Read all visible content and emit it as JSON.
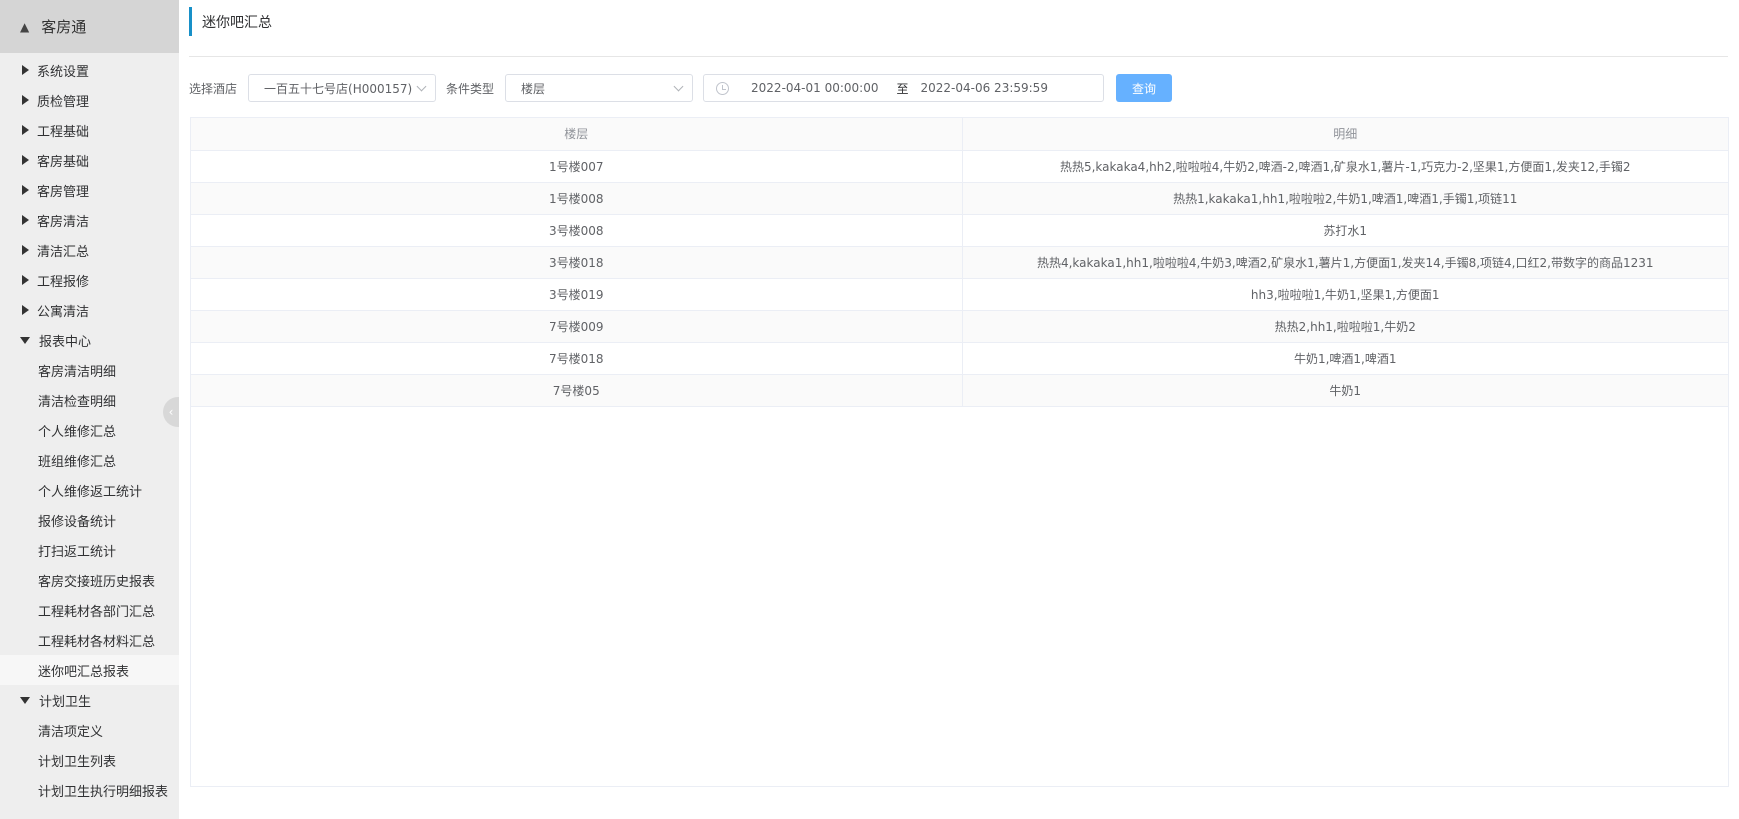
{
  "app": {
    "title": "客房通",
    "home_icon": "home-icon"
  },
  "sidebar": {
    "groups": [
      {
        "label": "系统设置",
        "expanded": false
      },
      {
        "label": "质检管理",
        "expanded": false
      },
      {
        "label": "工程基础",
        "expanded": false
      },
      {
        "label": "客房基础",
        "expanded": false
      },
      {
        "label": "客房管理",
        "expanded": false
      },
      {
        "label": "客房清洁",
        "expanded": false
      },
      {
        "label": "清洁汇总",
        "expanded": false
      },
      {
        "label": "工程报修",
        "expanded": false
      },
      {
        "label": "公寓清洁",
        "expanded": false
      },
      {
        "label": "报表中心",
        "expanded": true,
        "children": [
          "客房清洁明细",
          "清洁检查明细",
          "个人维修汇总",
          "班组维修汇总",
          "个人维修返工统计",
          "报修设备统计",
          "打扫返工统计",
          "客房交接班历史报表",
          "工程耗材各部门汇总",
          "工程耗材各材料汇总",
          "迷你吧汇总报表"
        ]
      },
      {
        "label": "计划卫生",
        "expanded": true,
        "children": [
          "清洁项定义",
          "计划卫生列表",
          "计划卫生执行明细报表"
        ]
      }
    ],
    "active": "迷你吧汇总报表"
  },
  "page": {
    "title": "迷你吧汇总"
  },
  "filters": {
    "hotel_label": "选择酒店",
    "hotel_value": "一百五十七号店(H000157)",
    "condition_label": "条件类型",
    "condition_value": "楼层",
    "date_start": "2022-04-01 00:00:00",
    "date_sep": "至",
    "date_end": "2022-04-06 23:59:59",
    "query_label": "查询"
  },
  "table": {
    "columns": [
      "楼层",
      "明细"
    ],
    "rows": [
      [
        "1号楼007",
        "热热5,kakaka4,hh2,啦啦啦4,牛奶2,啤酒-2,啤酒1,矿泉水1,薯片-1,巧克力-2,坚果1,方便面1,发夹12,手镯2"
      ],
      [
        "1号楼008",
        "热热1,kakaka1,hh1,啦啦啦2,牛奶1,啤酒1,啤酒1,手镯1,项链11"
      ],
      [
        "3号楼008",
        "苏打水1"
      ],
      [
        "3号楼018",
        "热热4,kakaka1,hh1,啦啦啦4,牛奶3,啤酒2,矿泉水1,薯片1,方便面1,发夹14,手镯8,项链4,口红2,带数字的商品1231"
      ],
      [
        "3号楼019",
        "hh3,啦啦啦1,牛奶1,坚果1,方便面1"
      ],
      [
        "7号楼009",
        "热热2,hh1,啦啦啦1,牛奶2"
      ],
      [
        "7号楼018",
        "牛奶1,啤酒1,啤酒1"
      ],
      [
        "7号楼05",
        "牛奶1"
      ]
    ]
  }
}
